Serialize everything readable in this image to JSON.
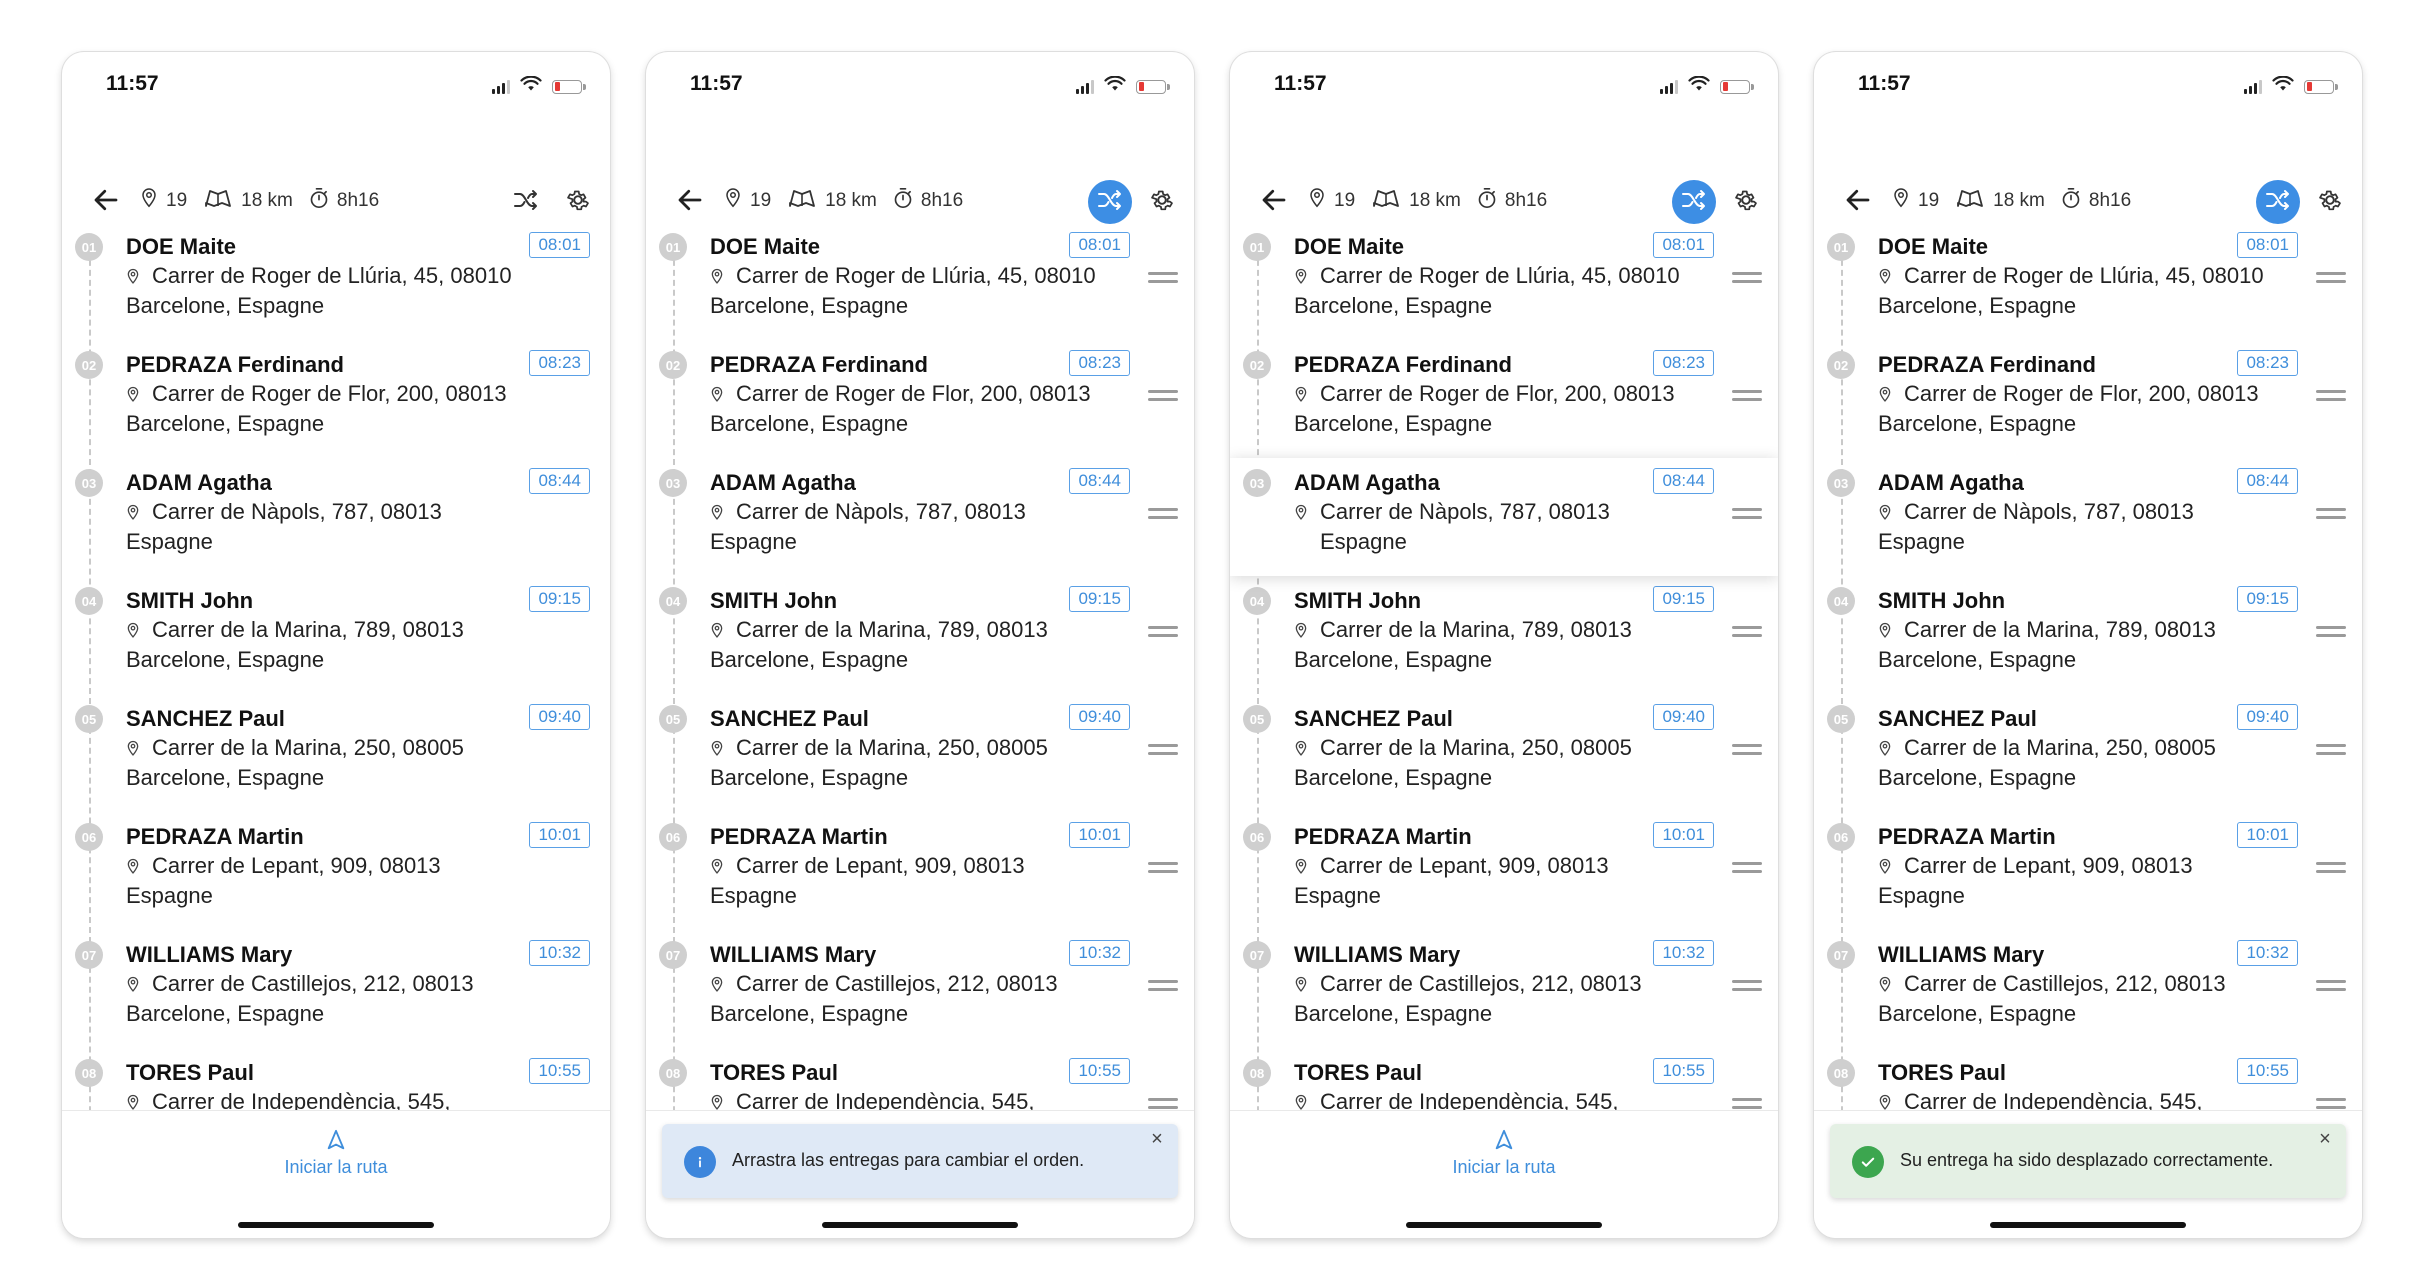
{
  "status_time": "11:57",
  "summary": {
    "stops": "19",
    "distance": "18 km",
    "duration": "8h16"
  },
  "colors": {
    "accent": "#3d8ee4",
    "badge": "#3f8edb",
    "info_toast": "#dfe9f6",
    "success_toast": "#e4f0e4"
  },
  "stops": [
    {
      "num": "01",
      "name": "DOE Maite",
      "addr1": "Carrer de Roger de Llúria, 45, 08010",
      "addr2": "Barcelone, Espagne",
      "time": "08:01"
    },
    {
      "num": "02",
      "name": "PEDRAZA Ferdinand",
      "addr1": "Carrer de Roger de Flor, 200, 08013",
      "addr2": "Barcelone, Espagne",
      "time": "08:23"
    },
    {
      "num": "03",
      "name": "ADAM Agatha",
      "addr1": "Carrer de Nàpols, 787, 08013",
      "addr2": "Espagne",
      "time": "08:44"
    },
    {
      "num": "04",
      "name": "SMITH John",
      "addr1": "Carrer de la Marina, 789, 08013",
      "addr2": "Barcelone, Espagne",
      "time": "09:15"
    },
    {
      "num": "05",
      "name": "SANCHEZ Paul",
      "addr1": "Carrer de la Marina, 250, 08005",
      "addr2": "Barcelone, Espagne",
      "time": "09:40"
    },
    {
      "num": "06",
      "name": "PEDRAZA Martin",
      "addr1": "Carrer de Lepant, 909, 08013",
      "addr2": "Espagne",
      "time": "10:01"
    },
    {
      "num": "07",
      "name": "WILLIAMS Mary",
      "addr1": "Carrer de Castillejos, 212, 08013",
      "addr2": "Barcelone, Espagne",
      "time": "10:32"
    },
    {
      "num": "08",
      "name": "TORES Paul",
      "addr1": "Carrer de Independència, 545,",
      "addr2": "",
      "time": "10:55"
    }
  ],
  "start_route_label": "Iniciar la ruta",
  "toast_info": "Arrastra las entregas para cambiar el orden.",
  "toast_success": "Su entrega ha sido desplazado correctamente.",
  "toast_close": "×",
  "screens": [
    {
      "shuffle_active": false,
      "drag_handles": false,
      "lifted_stop": null,
      "bottom": "start"
    },
    {
      "shuffle_active": true,
      "drag_handles": true,
      "lifted_stop": null,
      "bottom": "info"
    },
    {
      "shuffle_active": true,
      "drag_handles": true,
      "lifted_stop": "03",
      "bottom": "start"
    },
    {
      "shuffle_active": true,
      "drag_handles": true,
      "lifted_stop": null,
      "bottom": "success"
    }
  ]
}
